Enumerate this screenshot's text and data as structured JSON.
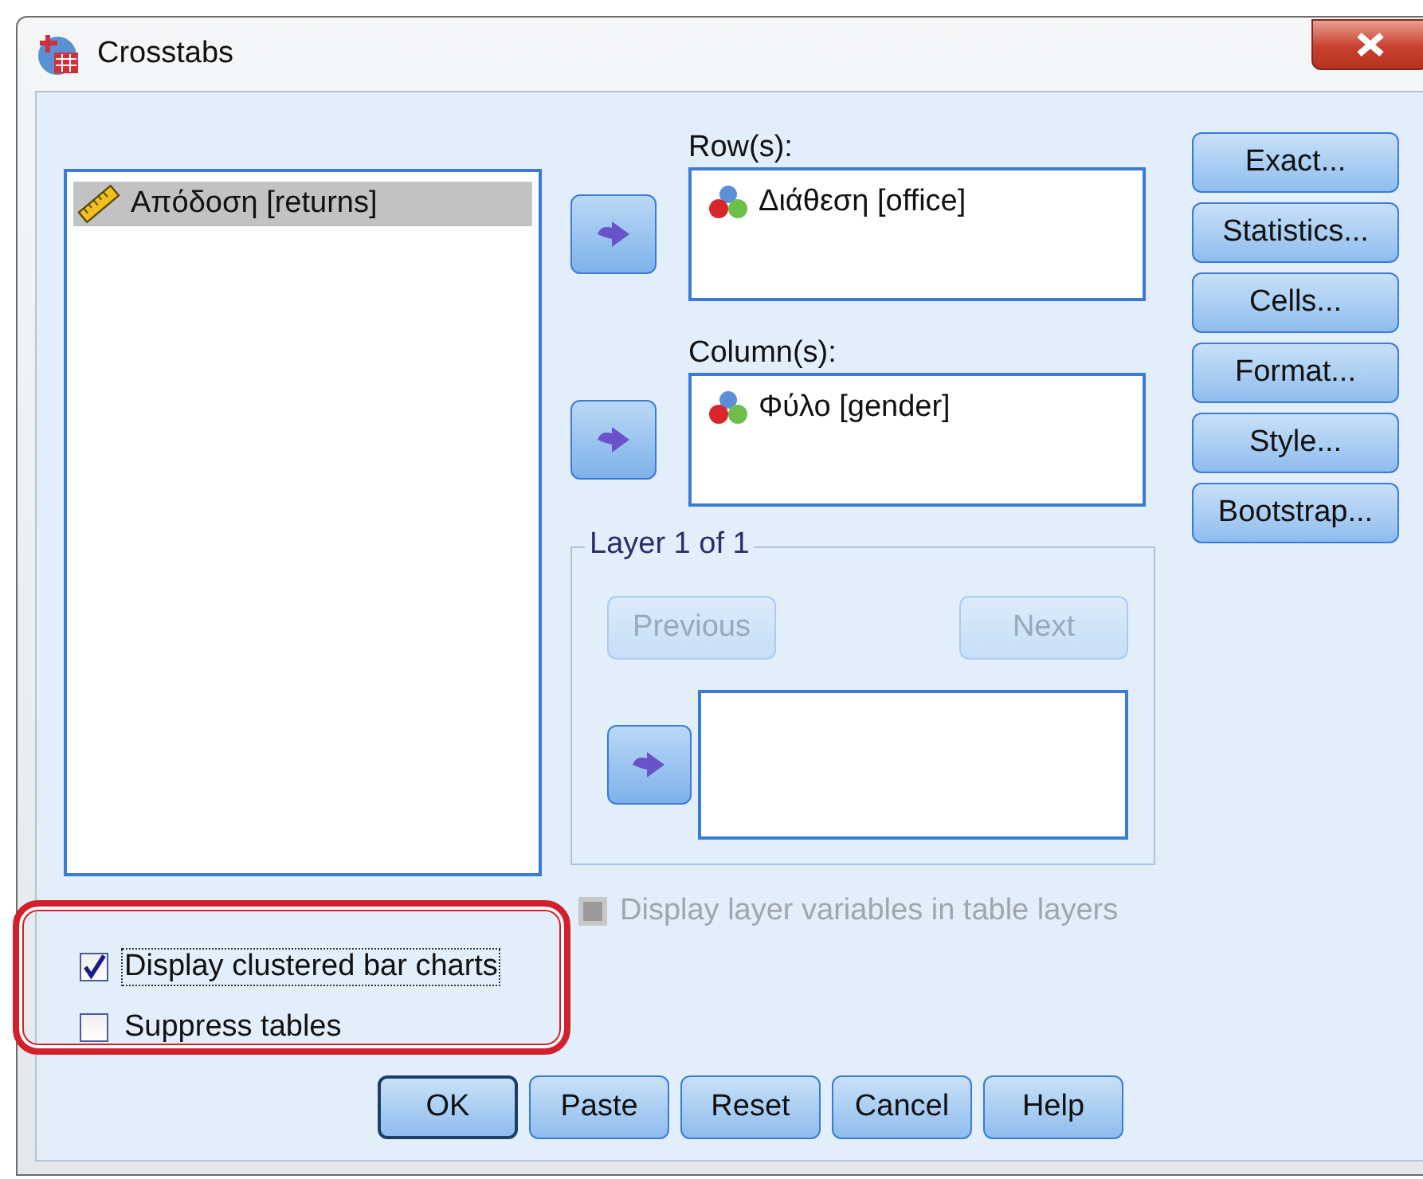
{
  "window": {
    "title": "Crosstabs"
  },
  "variables": [
    {
      "label": "Απόδοση [returns]",
      "kind": "scale",
      "selected": true
    }
  ],
  "rows": {
    "label": "Row(s):",
    "items": [
      {
        "label": "Διάθεση [office]",
        "kind": "nominal"
      }
    ]
  },
  "columns": {
    "label": "Column(s):",
    "items": [
      {
        "label": "Φύλο [gender]",
        "kind": "nominal"
      }
    ]
  },
  "layer": {
    "title": "Layer 1 of 1",
    "previous": {
      "label": "Previous",
      "disabled": true
    },
    "next": {
      "label": "Next",
      "disabled": true
    }
  },
  "layer_option": {
    "label": "Display layer variables in table layers",
    "checked": false,
    "disabled": true
  },
  "side_buttons": [
    "Exact...",
    "Statistics...",
    "Cells...",
    "Format...",
    "Style...",
    "Bootstrap..."
  ],
  "options": [
    {
      "label": "Display clustered bar charts",
      "checked": true,
      "focused": true
    },
    {
      "label": "Suppress tables",
      "checked": false,
      "focused": false
    }
  ],
  "buttons": [
    {
      "label": "OK",
      "default": true
    },
    {
      "label": "Paste",
      "default": false
    },
    {
      "label": "Reset",
      "default": false
    },
    {
      "label": "Cancel",
      "default": false
    },
    {
      "label": "Help",
      "default": false
    }
  ]
}
